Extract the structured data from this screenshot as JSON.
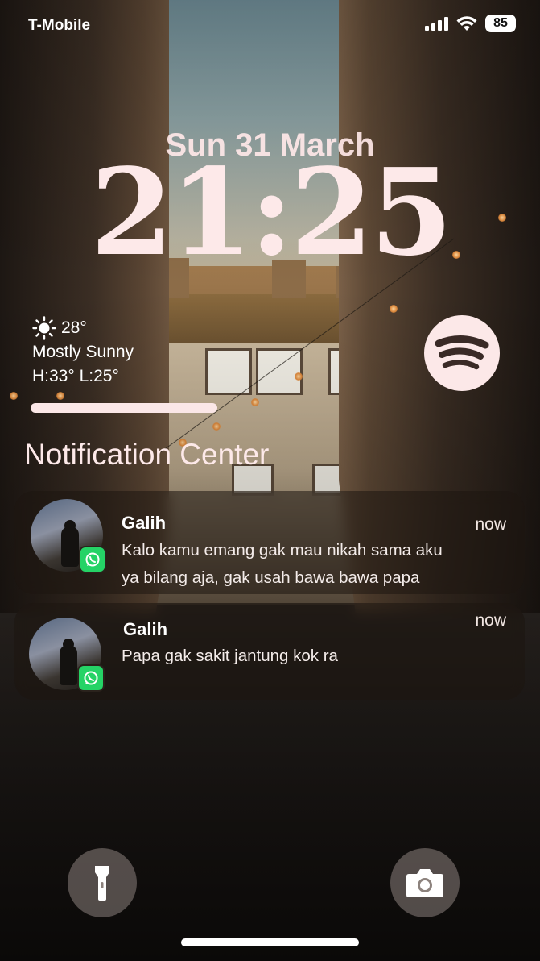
{
  "status_bar": {
    "carrier": "T-Mobile",
    "battery": "85"
  },
  "lock_screen": {
    "date": "Sun 31 March",
    "time": "21:25"
  },
  "weather": {
    "icon": "sun-icon",
    "temperature": "28°",
    "condition": "Mostly Sunny",
    "high_low": "H:33° L:25°"
  },
  "spotify": {
    "icon": "spotify-icon"
  },
  "notification_center": {
    "title": "Notification Center",
    "notifications": [
      {
        "sender": "Galih",
        "time": "now",
        "app_icon": "whatsapp-icon",
        "line1": "Kalo kamu emang gak mau nikah sama aku",
        "line2": "ya bilang aja, gak usah bawa bawa papa"
      },
      {
        "sender": "Galih",
        "time": "now",
        "app_icon": "whatsapp-icon",
        "line1": "Papa gak sakit jantung kok ra",
        "line2": ""
      }
    ]
  },
  "quick_actions": {
    "left": "flashlight-icon",
    "right": "camera-icon"
  },
  "colors": {
    "accent_pink": "#fde9e9",
    "whatsapp_green": "#25d366"
  }
}
